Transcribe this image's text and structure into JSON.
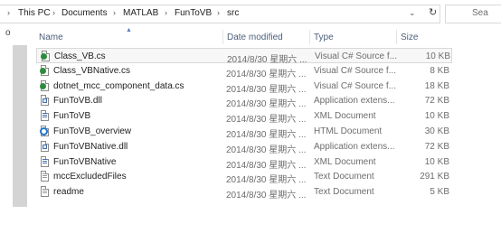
{
  "address": {
    "left_marker": "›",
    "crumbs": [
      "This PC",
      "Documents",
      "MATLAB",
      "FunToVB",
      "src"
    ],
    "separator": "›",
    "dropdown_glyph": "⌄",
    "refresh_glyph": "↻",
    "search_placeholder": "Sea"
  },
  "left_pane": {
    "marker": "o"
  },
  "columns": {
    "name": "Name",
    "date": "Date modified",
    "type": "Type",
    "size": "Size"
  },
  "files": [
    {
      "name": "Class_VB.cs",
      "date": "2014/8/30 星期六 ...",
      "type": "Visual C# Source f...",
      "size": "10 KB",
      "icon": "csharp-file-icon",
      "selected": true
    },
    {
      "name": "Class_VBNative.cs",
      "date": "2014/8/30 星期六 ...",
      "type": "Visual C# Source f...",
      "size": "8 KB",
      "icon": "csharp-file-icon"
    },
    {
      "name": "dotnet_mcc_component_data.cs",
      "date": "2014/8/30 星期六 ...",
      "type": "Visual C# Source f...",
      "size": "18 KB",
      "icon": "csharp-file-icon"
    },
    {
      "name": "FunToVB.dll",
      "date": "2014/8/30 星期六 ...",
      "type": "Application extens...",
      "size": "72 KB",
      "icon": "dll-file-icon"
    },
    {
      "name": "FunToVB",
      "date": "2014/8/30 星期六 ...",
      "type": "XML Document",
      "size": "10 KB",
      "icon": "xml-file-icon"
    },
    {
      "name": "FunToVB_overview",
      "date": "2014/8/30 星期六 ...",
      "type": "HTML Document",
      "size": "30 KB",
      "icon": "html-file-icon"
    },
    {
      "name": "FunToVBNative.dll",
      "date": "2014/8/30 星期六 ...",
      "type": "Application extens...",
      "size": "72 KB",
      "icon": "dll-file-icon"
    },
    {
      "name": "FunToVBNative",
      "date": "2014/8/30 星期六 ...",
      "type": "XML Document",
      "size": "10 KB",
      "icon": "xml-file-icon"
    },
    {
      "name": "mccExcludedFiles",
      "date": "2014/8/30 星期六 ...",
      "type": "Text Document",
      "size": "291 KB",
      "icon": "text-file-icon"
    },
    {
      "name": "readme",
      "date": "2014/8/30 星期六 ...",
      "type": "Text Document",
      "size": "5 KB",
      "icon": "text-file-icon"
    }
  ]
}
